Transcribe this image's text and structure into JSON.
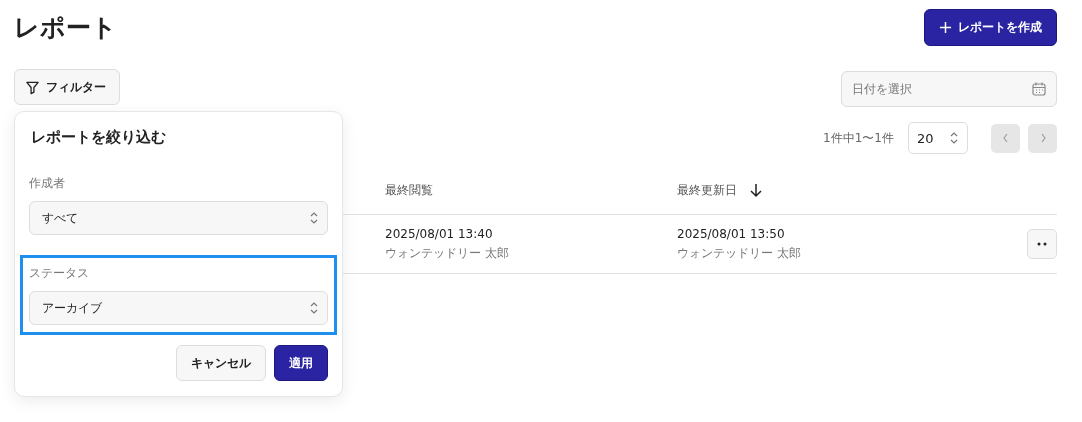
{
  "page": {
    "title": "レポート"
  },
  "create_button": {
    "label": "レポートを作成"
  },
  "filter_button": {
    "label": "フィルター"
  },
  "date_field": {
    "placeholder": "日付を選択"
  },
  "pagination": {
    "summary": "1件中1〜1件",
    "page_size": "20"
  },
  "table": {
    "columns": [
      {
        "label": "最終閲覧",
        "sorted": false
      },
      {
        "label": "最終更新日",
        "sorted": true
      }
    ],
    "rows": [
      {
        "cells": [
          {
            "date": "2025/08/01 13:40",
            "user": "ウォンテッドリー 太郎"
          },
          {
            "date": "2025/08/01 13:50",
            "user": "ウォンテッドリー 太郎"
          }
        ]
      }
    ]
  },
  "filter_panel": {
    "title": "レポートを絞り込む",
    "fields": [
      {
        "label": "作成者",
        "value": "すべて",
        "focused": false
      },
      {
        "label": "ステータス",
        "value": "アーカイブ",
        "focused": true
      }
    ],
    "buttons": [
      {
        "label": "キャンセル",
        "kind": "secondary"
      },
      {
        "label": "適用",
        "kind": "primary"
      }
    ]
  }
}
